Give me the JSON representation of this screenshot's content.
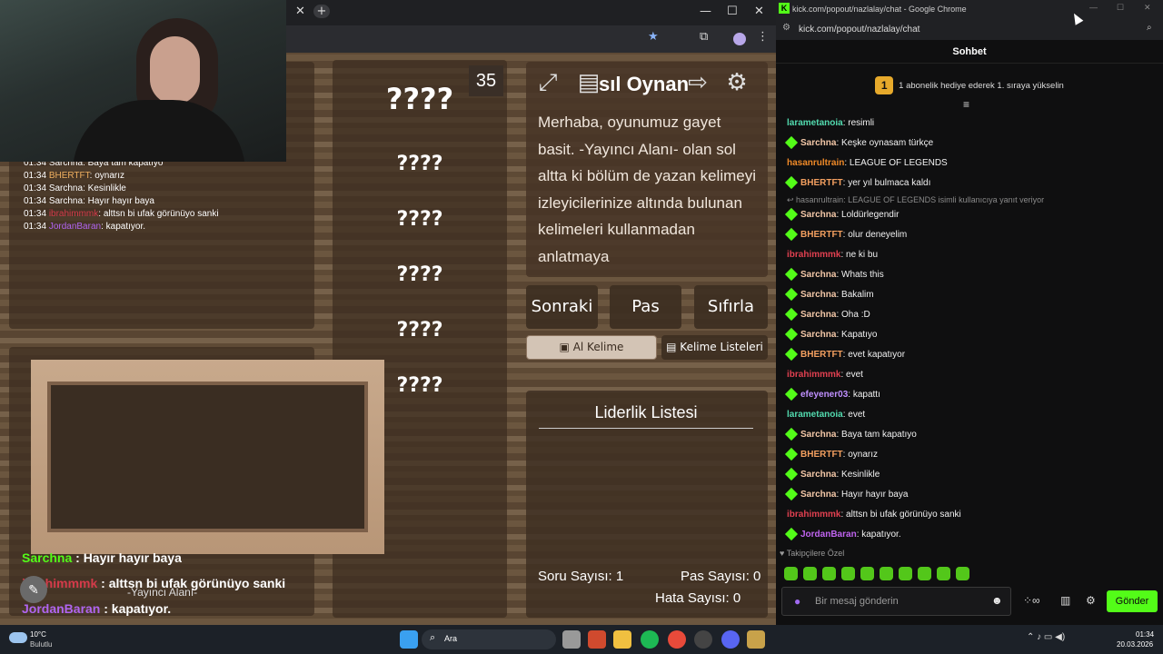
{
  "game_window": {
    "counter": "35",
    "title_partial": "sıl Oynan",
    "words": [
      "????",
      "????",
      "????",
      "????",
      "????",
      "????"
    ],
    "instructions": "Merhaba, oyunumuz gayet basit. -Yayıncı Alanı- olan sol altta ki bölüm de yazan kelimeyi izleyicilerinize altında bulunan kelimeleri kullanmadan anlatmaya",
    "buttons": {
      "next": "Sonraki",
      "pass": "Pas",
      "reset": "Sıfırla",
      "get_word": "Al Kelime",
      "word_lists": "Kelime Listeleri"
    },
    "leaderboard_title": "Liderlik Listesi",
    "stats": {
      "questions": "Soru Sayısı: 1",
      "passes": "Pas Sayısı: 0",
      "errors": "Hata Sayısı: 0"
    },
    "streamer_area": "-Yayıncı Alanı-",
    "overlay_chat": [
      {
        "time": "01:34",
        "user": "Sarchna",
        "text": "Baya tam kapatıyo",
        "color": "#ffffff"
      },
      {
        "time": "01:34",
        "user": "BHERTFT",
        "text": "oynarız",
        "color": "#f0b060"
      },
      {
        "time": "01:34",
        "user": "Sarchna",
        "text": "Kesinlikle",
        "color": "#ffffff"
      },
      {
        "time": "01:34",
        "user": "Sarchna",
        "text": "Hayır hayır baya",
        "color": "#ffffff"
      },
      {
        "time": "01:34",
        "user": "ibrahimmmk",
        "text": "alttsn bi ufak görünüyo sanki",
        "color": "#d43b4a"
      },
      {
        "time": "01:34",
        "user": "JordanBaran",
        "text": "kapatıyor.",
        "color": "#b064f0"
      }
    ],
    "big_chat": [
      {
        "user": "Sarchna",
        "text": "Hayır hayır baya",
        "color": "#53fc18"
      },
      {
        "user": "ibrahimmmk",
        "text": "alttsn bi ufak görünüyo sanki",
        "color": "#d43b4a"
      },
      {
        "user": "JordanBaran",
        "text": "kapatıyor.",
        "color": "#b064f0"
      }
    ]
  },
  "popout": {
    "window_title": "kick.com/popout/nazlalay/chat - Google Chrome",
    "url": "kick.com/popout/nazlalay/chat",
    "header": "Sohbet",
    "pinned": {
      "rank": "1",
      "text": "1 abonelik hediye ederek 1. sıraya yükselin"
    },
    "messages": [
      {
        "user": "larametanoia",
        "text": "resimli",
        "color": "#53dcb0",
        "badge": false
      },
      {
        "user": "Sarchna",
        "text": "Keşke oynasam türkçe",
        "color": "#f4c8a8",
        "badge": true
      },
      {
        "user": "hasanrultrain",
        "text": "LEAGUE OF LEGENDS",
        "color": "#f08a28",
        "badge": false
      },
      {
        "user": "BHERTFT",
        "text": "yer yıl bulmaca kaldı",
        "color": "#f4a060",
        "badge": true
      },
      {
        "reply": "hasanrultrain: LEAGUE OF LEGENDS isimli kullanıcıya yanıt veriyor"
      },
      {
        "user": "Sarchna",
        "text": "Loldürlegendir",
        "color": "#f4c8a8",
        "badge": true
      },
      {
        "user": "BHERTFT",
        "text": "olur deneyelim",
        "color": "#f4a060",
        "badge": true
      },
      {
        "user": "ibrahimmmk",
        "text": "ne ki bu",
        "color": "#e04050",
        "badge": false
      },
      {
        "user": "Sarchna",
        "text": "Whats this",
        "color": "#f4c8a8",
        "badge": true
      },
      {
        "user": "Sarchna",
        "text": "Bakalim",
        "color": "#f4c8a8",
        "badge": true
      },
      {
        "user": "Sarchna",
        "text": "Oha :D",
        "color": "#f4c8a8",
        "badge": true
      },
      {
        "user": "Sarchna",
        "text": "Kapatıyo",
        "color": "#f4c8a8",
        "badge": true
      },
      {
        "user": "BHERTFT",
        "text": "evet kapatıyor",
        "color": "#f4a060",
        "badge": true
      },
      {
        "user": "ibrahimmmk",
        "text": "evet",
        "color": "#e04050",
        "badge": false
      },
      {
        "user": "efeyener03",
        "text": "kapattı",
        "color": "#c090ff",
        "badge": true
      },
      {
        "user": "larametanoia",
        "text": "evet",
        "color": "#53dcb0",
        "badge": false
      },
      {
        "user": "Sarchna",
        "text": "Baya tam kapatıyo",
        "color": "#f4c8a8",
        "badge": true
      },
      {
        "user": "BHERTFT",
        "text": "oynarız",
        "color": "#f4a060",
        "badge": true
      },
      {
        "user": "Sarchna",
        "text": "Kesinlikle",
        "color": "#f4c8a8",
        "badge": true
      },
      {
        "user": "Sarchna",
        "text": "Hayır hayır baya",
        "color": "#f4c8a8",
        "badge": true
      },
      {
        "user": "ibrahimmmk",
        "text": "alttsn bi ufak görünüyo sanki",
        "color": "#e04050",
        "badge": false
      },
      {
        "user": "JordanBaran",
        "text": "kapatıyor.",
        "color": "#c064f0",
        "badge": true
      }
    ],
    "followers_only": "Takipçilere Özel",
    "input_placeholder": "Bir mesaj gönderin",
    "send_label": "Gönder"
  },
  "taskbar": {
    "weather_temp": "10°C",
    "weather_text": "Bulutlu",
    "search": "Ara",
    "time": "01:34",
    "date": "20.03.2026"
  }
}
